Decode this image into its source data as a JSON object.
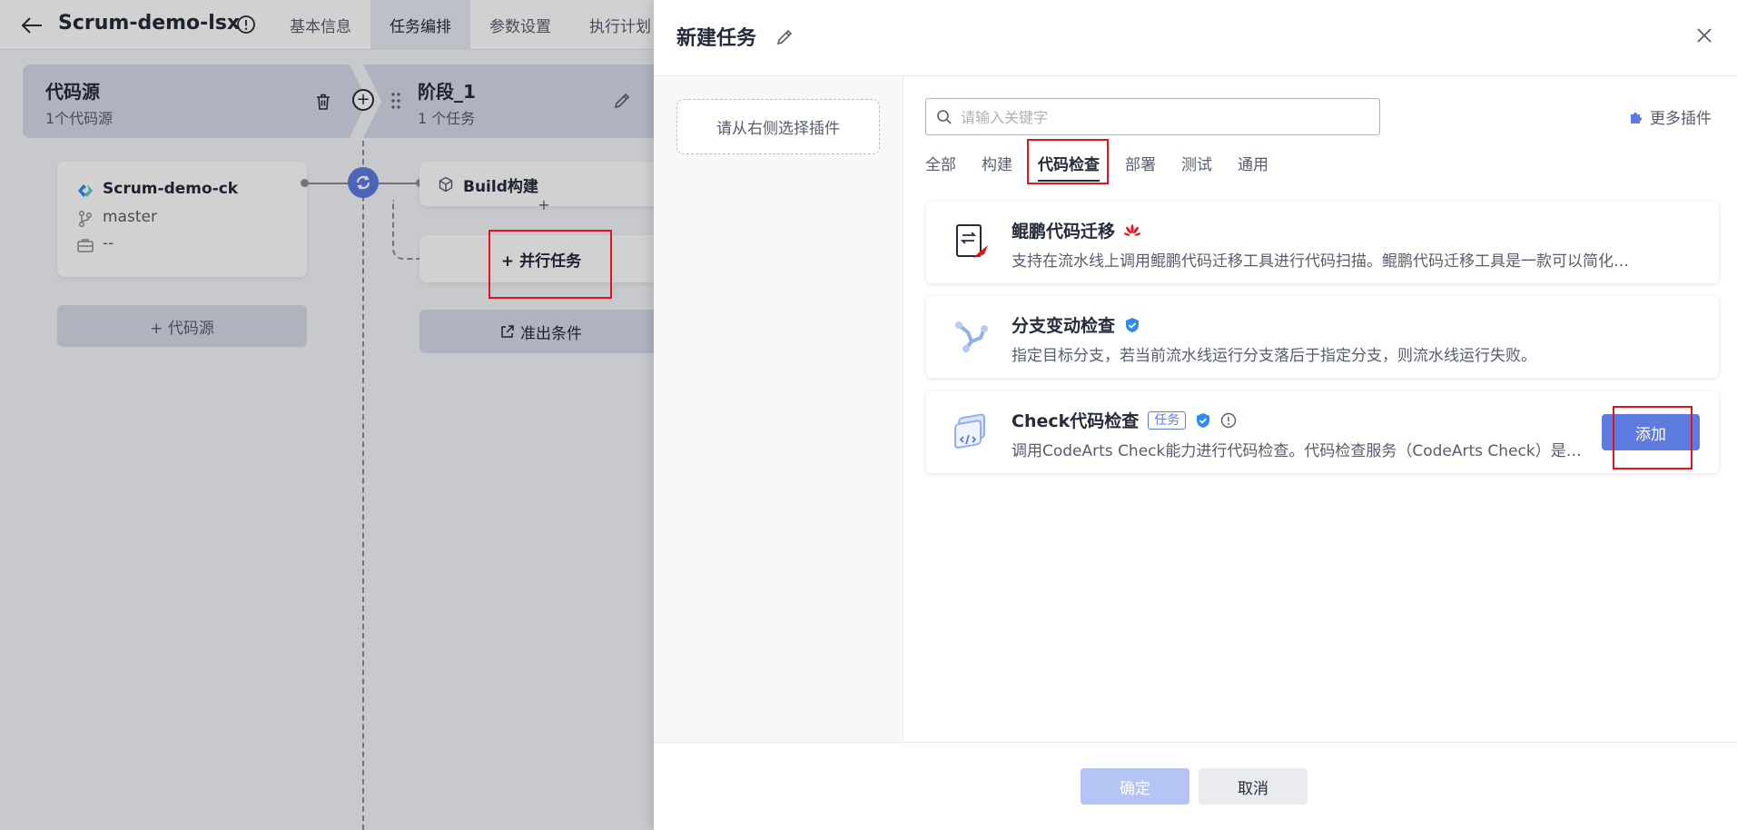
{
  "pipeline": {
    "title": "Scrum-demo-lsx",
    "tabs": [
      {
        "label": "基本信息"
      },
      {
        "label": "任务编排"
      },
      {
        "label": "参数设置"
      },
      {
        "label": "执行计划"
      }
    ]
  },
  "stages": {
    "source": {
      "title": "代码源",
      "subtitle": "1个代码源"
    },
    "stage1": {
      "title": "阶段_1",
      "subtitle": "1 个任务"
    }
  },
  "source_card": {
    "name": "Scrum-demo-ck",
    "branch": "master",
    "extra": "--"
  },
  "add_source_label": "+ 代码源",
  "build_card": {
    "label": "Build构建"
  },
  "parallel_task_label": "+ 并行任务",
  "exit_condition_label": "准出条件",
  "drawer": {
    "title": "新建任务",
    "left_placeholder": "请从右侧选择插件",
    "search_placeholder": "请输入关键字",
    "more_plugins": "更多插件",
    "categories": [
      {
        "label": "全部"
      },
      {
        "label": "构建"
      },
      {
        "label": "代码检查"
      },
      {
        "label": "部署"
      },
      {
        "label": "测试"
      },
      {
        "label": "通用"
      }
    ],
    "active_category": "代码检查",
    "plugins": [
      {
        "name": "鲲鹏代码迁移",
        "desc": "支持在流水线上调用鲲鹏代码迁移工具进行代码扫描。鲲鹏代码迁移工具是一款可以简化…"
      },
      {
        "name": "分支变动检查",
        "desc": "指定目标分支，若当前流水线运行分支落后于指定分支，则流水线运行失败。"
      },
      {
        "name": "Check代码检查",
        "badge": "任务",
        "desc": "调用CodeArts Check能力进行代码检查。代码检查服务（CodeArts Check）是基…",
        "add_label": "添加"
      }
    ],
    "footer": {
      "ok_label": "确定",
      "cancel_label": "取消"
    }
  },
  "colors": {
    "primary": "#5e7ce0",
    "highlight": "#e1161d",
    "text": "#252b3a"
  }
}
